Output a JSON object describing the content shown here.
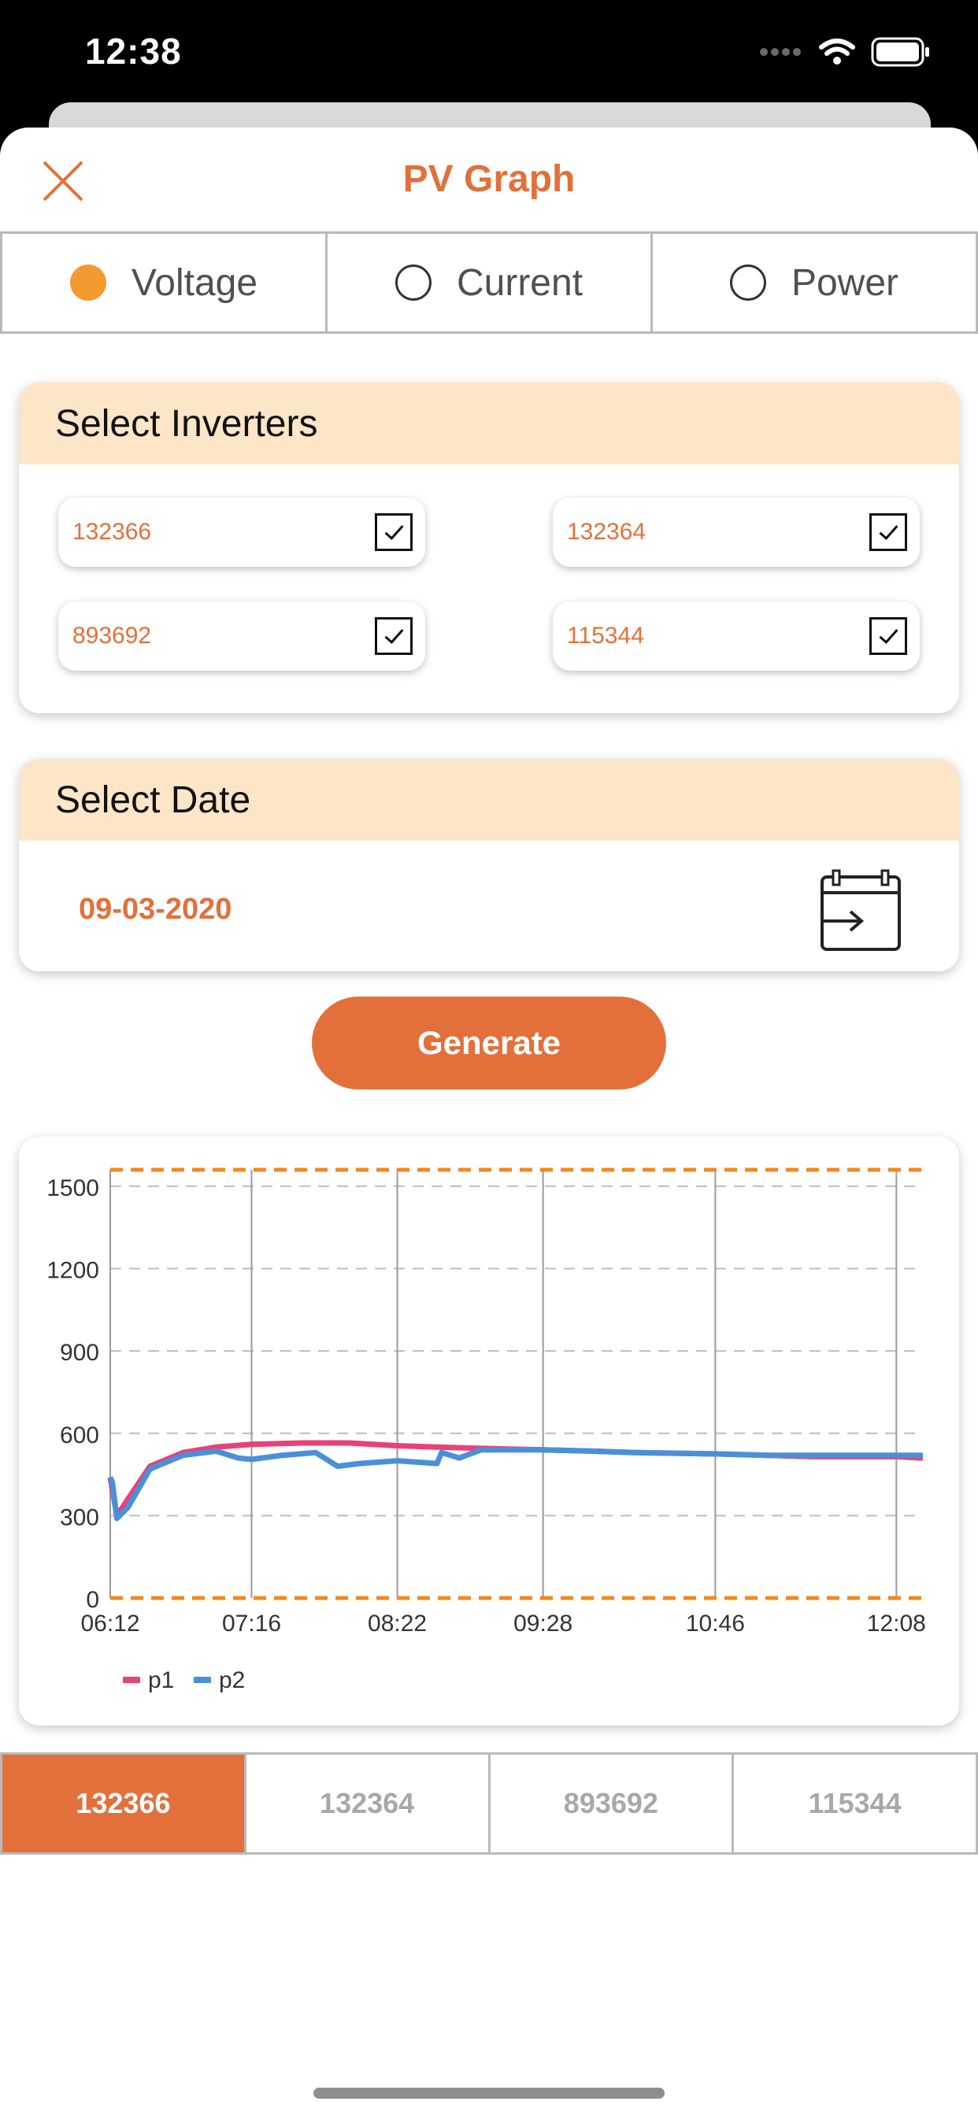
{
  "status": {
    "time": "12:38"
  },
  "nav": {
    "title": "PV Graph",
    "close_icon": "close-icon"
  },
  "measure": {
    "options": [
      {
        "label": "Voltage",
        "selected": true
      },
      {
        "label": "Current",
        "selected": false
      },
      {
        "label": "Power",
        "selected": false
      }
    ]
  },
  "inverters": {
    "heading": "Select Inverters",
    "items": [
      {
        "id": "132366",
        "checked": true
      },
      {
        "id": "132364",
        "checked": true
      },
      {
        "id": "893692",
        "checked": true
      },
      {
        "id": "115344",
        "checked": true
      }
    ]
  },
  "date": {
    "heading": "Select Date",
    "value": "09-03-2020",
    "icon": "calendar-icon"
  },
  "generate_label": "Generate",
  "colors": {
    "accent": "#e3703a",
    "p1": "#e8417a",
    "p2": "#4a90d9",
    "limit": "#f08a1c"
  },
  "chart_data": {
    "type": "line",
    "xlabel": "",
    "ylabel": "",
    "ylim": [
      0,
      1560
    ],
    "yticks": [
      0,
      300,
      600,
      900,
      1200,
      1500
    ],
    "xticks": [
      "06:12",
      "07:16",
      "08:22",
      "09:28",
      "10:46",
      "12:08"
    ],
    "grid": true,
    "legend": "bottom-left",
    "limits": [
      1560,
      0
    ],
    "series": [
      {
        "name": "p1",
        "x": [
          "06:12",
          "06:15",
          "06:20",
          "06:30",
          "06:45",
          "07:00",
          "07:16",
          "07:40",
          "08:00",
          "08:22",
          "08:40",
          "09:00",
          "09:28",
          "09:50",
          "10:10",
          "10:46",
          "11:10",
          "11:30",
          "11:50",
          "12:08",
          "12:20"
        ],
        "values": [
          440,
          300,
          360,
          480,
          530,
          550,
          560,
          565,
          565,
          555,
          550,
          545,
          540,
          535,
          530,
          525,
          520,
          515,
          515,
          515,
          510
        ]
      },
      {
        "name": "p2",
        "x": [
          "06:12",
          "06:13",
          "06:15",
          "06:20",
          "06:30",
          "06:45",
          "07:00",
          "07:10",
          "07:16",
          "07:30",
          "07:45",
          "07:55",
          "08:05",
          "08:22",
          "08:40",
          "08:42",
          "08:50",
          "09:00",
          "09:28",
          "09:50",
          "10:10",
          "10:46",
          "11:10",
          "11:30",
          "11:50",
          "12:08",
          "12:20"
        ],
        "values": [
          440,
          420,
          290,
          330,
          470,
          520,
          535,
          510,
          505,
          520,
          530,
          480,
          490,
          500,
          490,
          530,
          510,
          540,
          540,
          535,
          530,
          525,
          520,
          520,
          520,
          520,
          520
        ]
      }
    ]
  },
  "tabs": [
    {
      "label": "132366",
      "active": true
    },
    {
      "label": "132364",
      "active": false
    },
    {
      "label": "893692",
      "active": false
    },
    {
      "label": "115344",
      "active": false
    }
  ]
}
